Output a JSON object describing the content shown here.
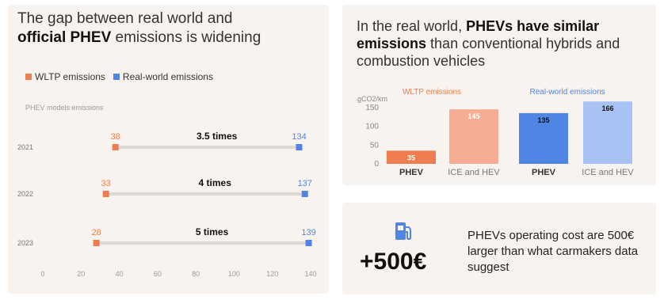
{
  "left_panel": {
    "title_line1": "The gap between real world and",
    "title_bold": "official PHEV",
    "title_rest": " emissions is widening",
    "legend": {
      "wltp_label": "WLTP emissions",
      "real_label": "Real-world emissions"
    },
    "subtitle": "PHEV models emissions"
  },
  "right_panel": {
    "title_pre": "In the real world, ",
    "title_bold": "PHEVs have similar emissions",
    "title_post": " than conventional hybrids and combustion vehicles"
  },
  "cost_panel": {
    "value": "+500€",
    "text": "PHEVs operating cost are 500€ larger than what carmakers data suggest",
    "icon": "fuel-pump-icon"
  },
  "colors": {
    "wltp": "#ef7d4f",
    "wltp_light": "#f6ad94",
    "real": "#4f86e6",
    "real_light": "#a8c2f3",
    "track": "#dcd8d4"
  },
  "chart_data": [
    {
      "type": "dumbbell",
      "title": "PHEV models emissions",
      "categories": [
        "2021",
        "2022",
        "2023"
      ],
      "series": [
        {
          "name": "WLTP emissions",
          "values": [
            38,
            33,
            28
          ]
        },
        {
          "name": "Real-world emissions",
          "values": [
            134,
            137,
            139
          ]
        }
      ],
      "annotations": [
        "3.5 times",
        "4 times",
        "5 times"
      ],
      "xlim": [
        0,
        140
      ],
      "xticks": [
        0,
        20,
        40,
        60,
        80,
        100,
        120,
        140
      ],
      "legend": "top-left"
    },
    {
      "type": "bar",
      "ylabel": "gCO2/km",
      "ylim": [
        0,
        160
      ],
      "yticks": [
        0,
        50,
        100,
        150
      ],
      "categories": [
        "PHEV",
        "ICE and HEV",
        "PHEV",
        "ICE and HEV"
      ],
      "groups": [
        "WLTP emissions",
        "Real-world emissions"
      ],
      "values": [
        35,
        145,
        135,
        166
      ],
      "value_labels": [
        "35",
        "145",
        "135",
        "166"
      ]
    }
  ]
}
